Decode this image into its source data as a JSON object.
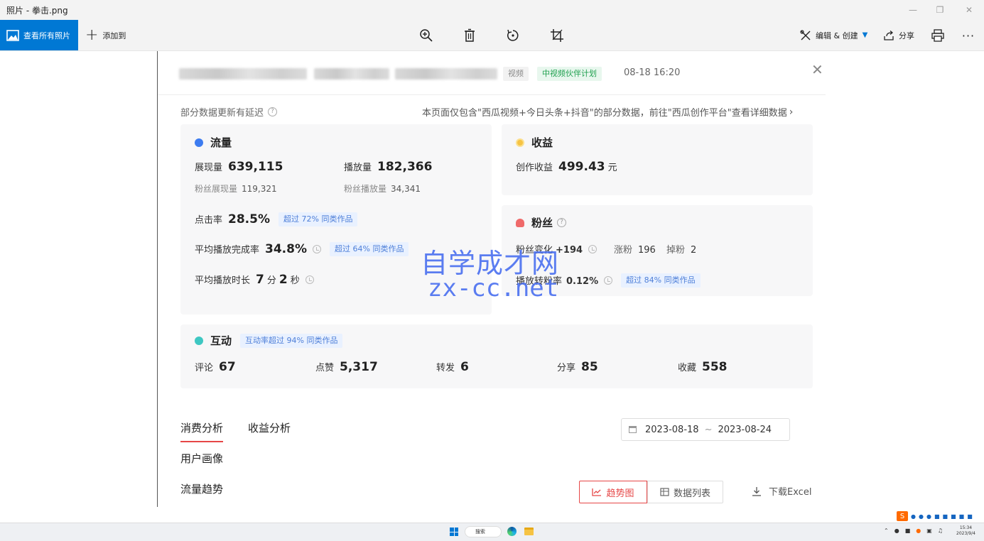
{
  "window": {
    "title": "照片 - 拳击.png"
  },
  "toolbar": {
    "view_all": "查看所有照片",
    "add_to": "添加到",
    "edit_create": "编辑 & 创建",
    "share": "分享"
  },
  "header": {
    "tag_video": "视频",
    "tag_program": "中视频伙伴计划",
    "time": "08-18 16:20"
  },
  "notice": {
    "delay": "部分数据更新有延迟",
    "scope": "本页面仅包含\"西瓜视频+今日头条+抖音\"的部分数据，前往\"西瓜创作平台\"查看详细数据"
  },
  "traffic": {
    "title": "流量",
    "impressions_label": "展现量",
    "impressions": "639,115",
    "plays_label": "播放量",
    "plays": "182,366",
    "fan_impressions_label": "粉丝展现量",
    "fan_impressions": "119,321",
    "fan_plays_label": "粉丝播放量",
    "fan_plays": "34,341",
    "ctr_label": "点击率",
    "ctr": "28.5%",
    "ctr_chip": "超过 72% 同类作品",
    "completion_label": "平均播放完成率",
    "completion": "34.8%",
    "completion_chip": "超过 64% 同类作品",
    "duration_label": "平均播放时长",
    "duration_min": "7",
    "min_unit": "分",
    "duration_sec": "2",
    "sec_unit": "秒"
  },
  "income": {
    "title": "收益",
    "label": "创作收益",
    "value": "499.43",
    "unit": "元"
  },
  "fans": {
    "title": "粉丝",
    "change_label": "粉丝变化",
    "change": "+194",
    "gain_label": "涨粉",
    "gain": "196",
    "loss_label": "掉粉",
    "loss": "2",
    "conv_label": "播放转粉率",
    "conv": "0.12%",
    "conv_chip": "超过 84% 同类作品"
  },
  "interaction": {
    "title": "互动",
    "chip": "互动率超过 94% 同类作品",
    "comment_label": "评论",
    "comment": "67",
    "like_label": "点赞",
    "like": "5,317",
    "repost_label": "转发",
    "repost": "6",
    "share_label": "分享",
    "share": "85",
    "fav_label": "收藏",
    "fav": "558"
  },
  "analysis": {
    "tab_consume": "消费分析",
    "tab_income": "收益分析",
    "date_start": "2023-08-18",
    "date_sep": "~",
    "date_end": "2023-08-24",
    "user_profile": "用户画像",
    "traffic_trend": "流量趋势",
    "btn_trend": "趋势图",
    "btn_list": "数据列表",
    "download": "下载Excel"
  },
  "watermark": {
    "line1": "自学成才网",
    "line2": "zx-cc.net"
  },
  "taskbar": {
    "search": "搜索",
    "time": "15:34",
    "date": "2023/9/4"
  },
  "colors": {
    "accent": "#0078d4",
    "red": "#e64646",
    "green": "#1fa04f",
    "chip_blue": "#4e7fd8"
  }
}
